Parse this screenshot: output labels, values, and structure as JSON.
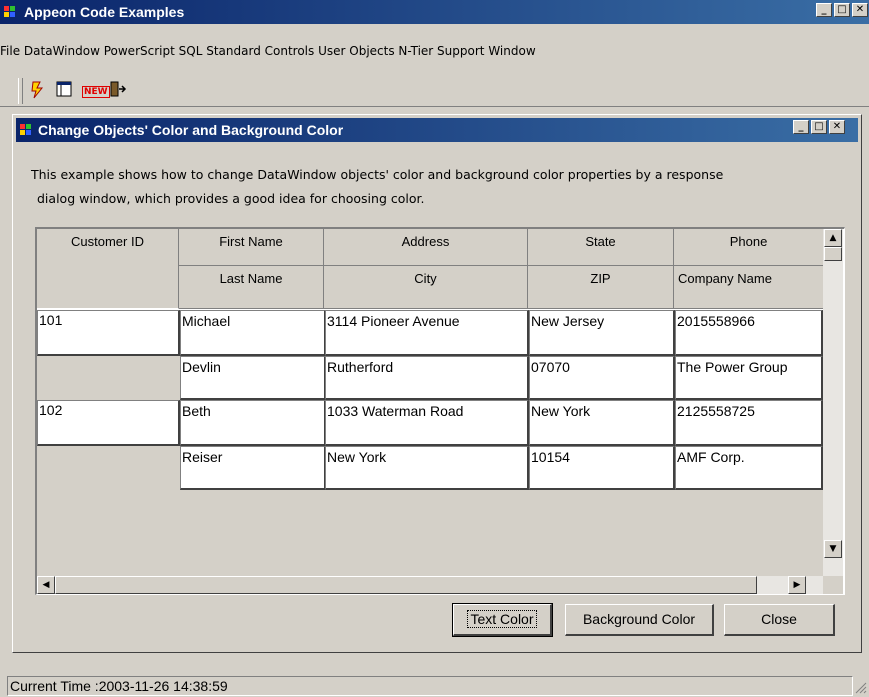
{
  "app": {
    "title": "Appeon Code Examples"
  },
  "menu": [
    "File",
    "DataWindow",
    "PowerScript",
    "SQL",
    "Standard Controls",
    "User Objects",
    "N-Tier Support",
    "Window"
  ],
  "toolbar": {
    "icons": [
      "lightning-icon",
      "window-icon",
      "new-icon",
      "exit-door-icon"
    ],
    "new_label": "NEW"
  },
  "caption_buttons": {
    "minimize": "_",
    "maximize": "□",
    "close": "✕"
  },
  "child": {
    "title": "Change Objects' Color and Background Color",
    "description_line1": "This example shows how to change DataWindow objects' color and background color properties by a response",
    "description_line2": "dialog window, which provides a good idea for choosing color."
  },
  "grid": {
    "headers_top": [
      "Customer ID",
      "First Name",
      "Address",
      "State",
      "Phone"
    ],
    "headers_bottom": [
      "Last Name",
      "City",
      "ZIP",
      "Company Name"
    ],
    "rows": [
      {
        "id": "101",
        "first_name": "Michael",
        "address": "3114 Pioneer Avenue",
        "state": "New Jersey",
        "phone": "2015558966",
        "last_name": "Devlin",
        "city": "Rutherford",
        "zip": "07070",
        "company": "The Power Group"
      },
      {
        "id": "102",
        "first_name": "Beth",
        "address": "1033 Waterman Road",
        "state": "New York",
        "phone": "2125558725",
        "last_name": "Reiser",
        "city": "New York",
        "zip": "10154",
        "company": "AMF Corp."
      }
    ]
  },
  "buttons": {
    "text_color": "Text Color",
    "background_color": "Background Color",
    "close": "Close"
  },
  "status": {
    "text": "Current Time :2003-11-26 14:38:59"
  }
}
